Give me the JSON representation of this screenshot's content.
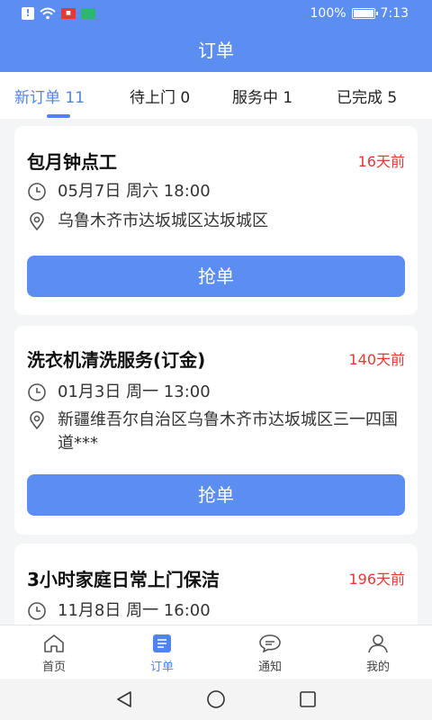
{
  "status_bar": {
    "battery": "100%",
    "battery_level": 1.0,
    "time": "7:13",
    "icons": [
      "alert-icon",
      "wifi-icon",
      "app-notification-icon",
      "green-app-icon"
    ]
  },
  "header": {
    "title": "订单"
  },
  "tabs": [
    {
      "label": "新订单 11",
      "active": true
    },
    {
      "label": "待上门 0",
      "active": false
    },
    {
      "label": "服务中 1",
      "active": false
    },
    {
      "label": "已完成 5",
      "active": false
    }
  ],
  "orders": [
    {
      "title": "包月钟点工",
      "ago": "16天前",
      "time": "05月7日 周六 18:00",
      "address": "乌鲁木齐市达坂城区达坂城区",
      "button": "抢单"
    },
    {
      "title": "洗衣机清洗服务(订金)",
      "ago": "140天前",
      "time": "01月3日 周一 13:00",
      "address": "新疆维吾尔自治区乌鲁木齐市达坂城区三一四国道***",
      "button": "抢单"
    },
    {
      "title": "3小时家庭日常上门保洁",
      "ago": "196天前",
      "time": "11月8日 周一 16:00",
      "address": "",
      "button": ""
    }
  ],
  "bottom_nav": [
    {
      "label": "首页",
      "icon": "home-icon",
      "active": false
    },
    {
      "label": "订单",
      "icon": "orders-icon",
      "active": true
    },
    {
      "label": "通知",
      "icon": "chat-bubble-icon",
      "active": false
    },
    {
      "label": "我的",
      "icon": "profile-icon",
      "active": false
    }
  ],
  "colors": {
    "primary": "#5b8ef0",
    "accent_text": "#4f84ee",
    "time_ago": "#e53935"
  }
}
